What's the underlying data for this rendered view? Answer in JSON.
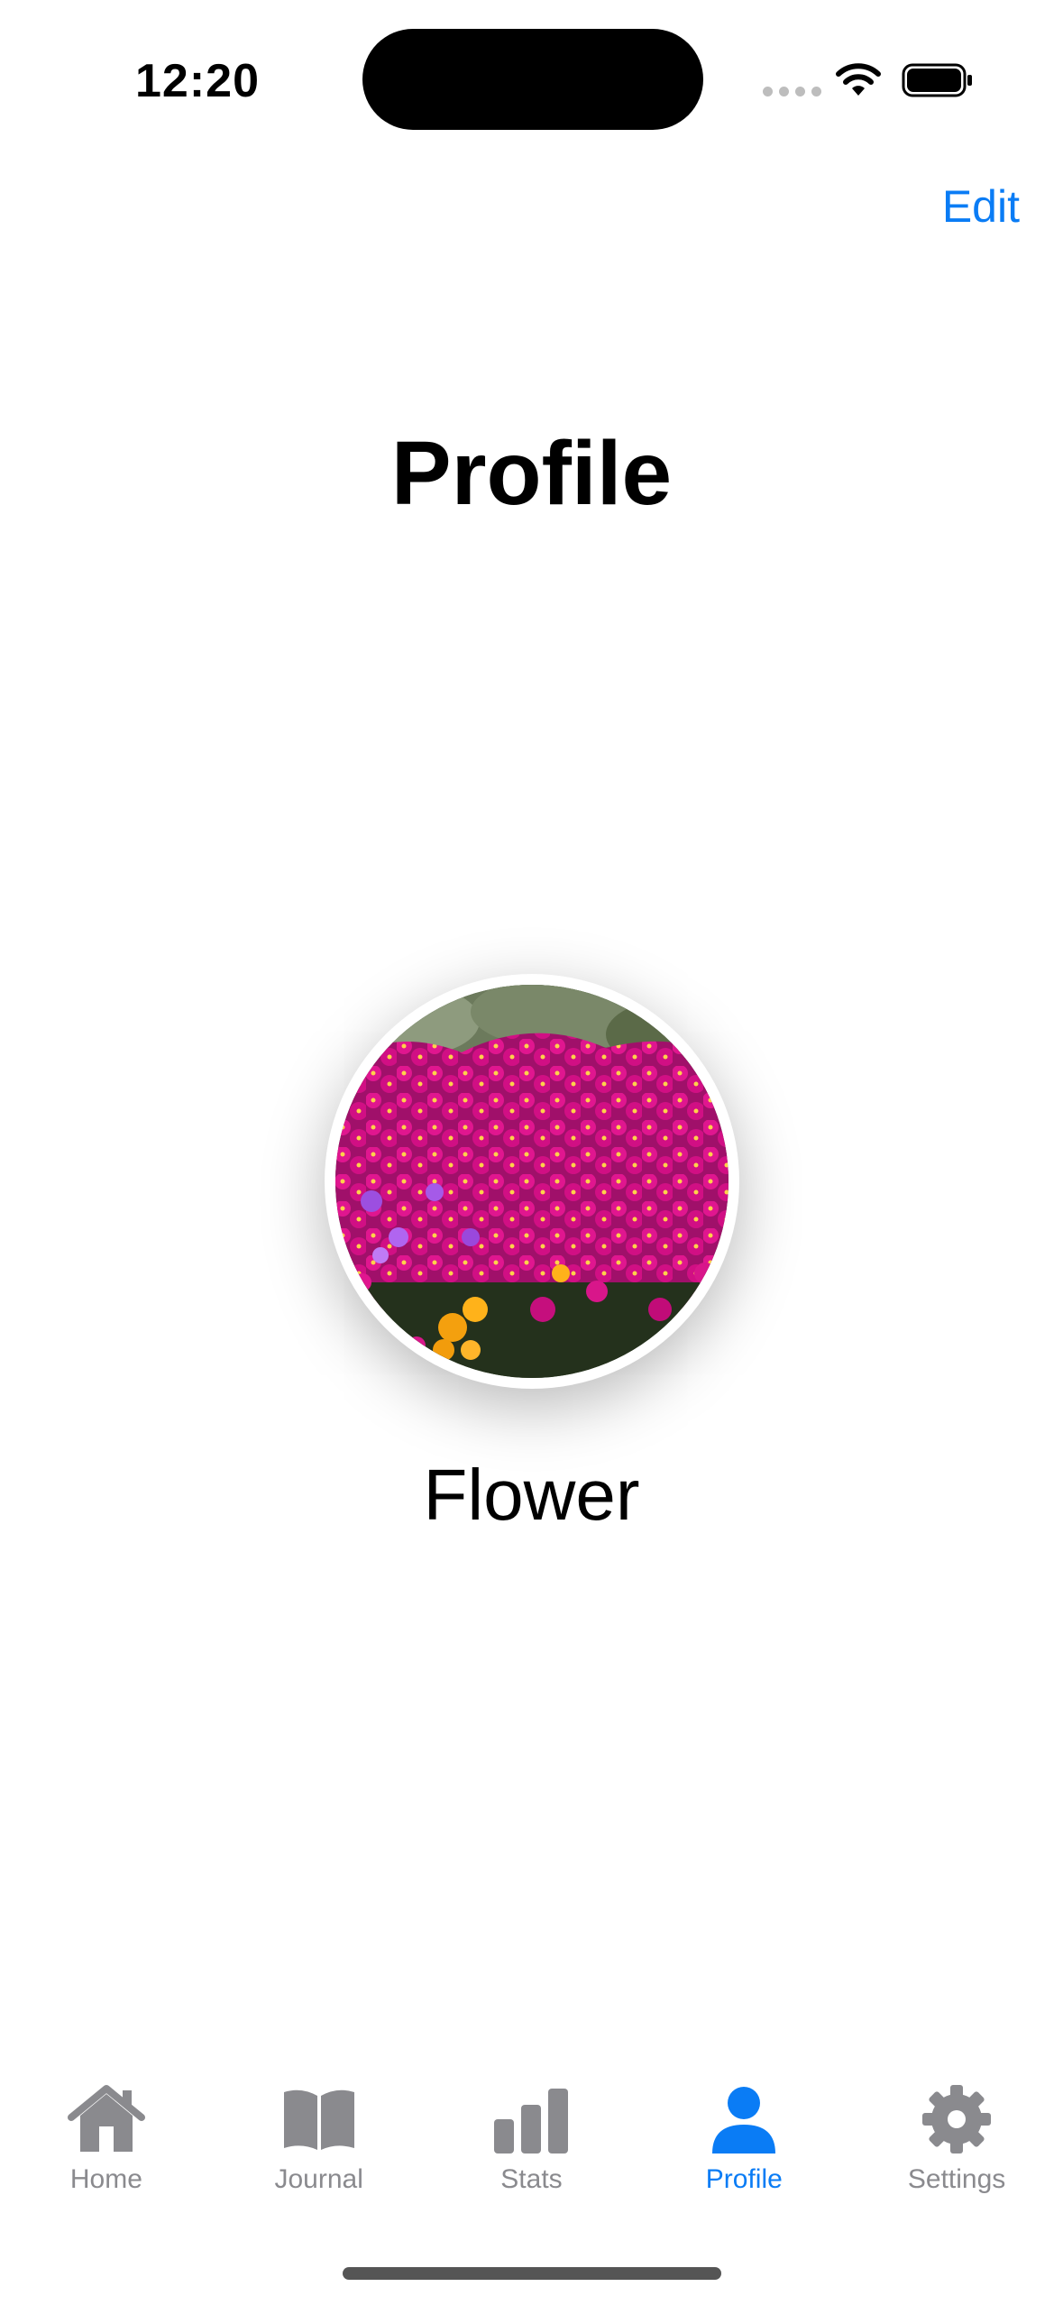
{
  "status_bar": {
    "time": "12:20"
  },
  "nav": {
    "edit_label": "Edit"
  },
  "page": {
    "title": "Profile"
  },
  "profile": {
    "name": "Flower",
    "avatar_icon": "flower-photo"
  },
  "tabs": [
    {
      "label": "Home",
      "icon": "house-icon",
      "active": false
    },
    {
      "label": "Journal",
      "icon": "book-icon",
      "active": false
    },
    {
      "label": "Stats",
      "icon": "chart-bar-icon",
      "active": false
    },
    {
      "label": "Profile",
      "icon": "person-icon",
      "active": true
    },
    {
      "label": "Settings",
      "icon": "gear-icon",
      "active": false
    }
  ],
  "colors": {
    "accent": "#0a7cf5",
    "inactive": "#8a8a8e"
  }
}
